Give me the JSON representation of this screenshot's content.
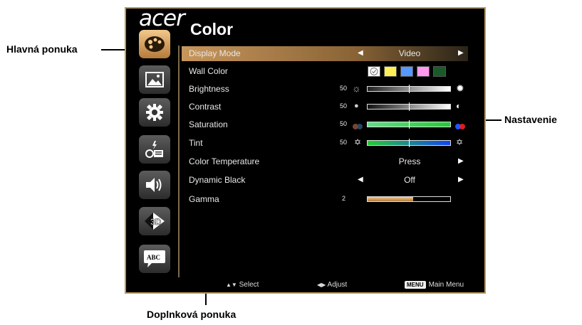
{
  "callouts": {
    "main_menu": "Hlavná ponuka",
    "settings": "Nastavenie",
    "submenu": "Doplnková ponuka"
  },
  "osd": {
    "logo": "acer",
    "title": "Color",
    "sidebar_icons": [
      "palette-icon",
      "picture-icon",
      "gear-icon",
      "projector-management-icon",
      "speaker-icon",
      "3d-icon",
      "abc-language-icon"
    ],
    "rows": [
      {
        "label": "Display Mode",
        "value": "Video"
      },
      {
        "label": "Wall Color"
      },
      {
        "label": "Brightness",
        "number": "50"
      },
      {
        "label": "Contrast",
        "number": "50"
      },
      {
        "label": "Saturation",
        "number": "50"
      },
      {
        "label": "Tint",
        "number": "50"
      },
      {
        "label": "Color Temperature",
        "value": "Press"
      },
      {
        "label": "Dynamic Black",
        "value": "Off"
      },
      {
        "label": "Gamma",
        "number": "2",
        "level": 0.55
      }
    ],
    "wall_colors": [
      "#ffffff",
      "#ffee55",
      "#5599ff",
      "#ff99ee",
      "#1a5a2a"
    ],
    "footer": {
      "select": "Select",
      "adjust": "Adjust",
      "menu_key": "MENU",
      "main_menu": "Main Menu"
    }
  }
}
